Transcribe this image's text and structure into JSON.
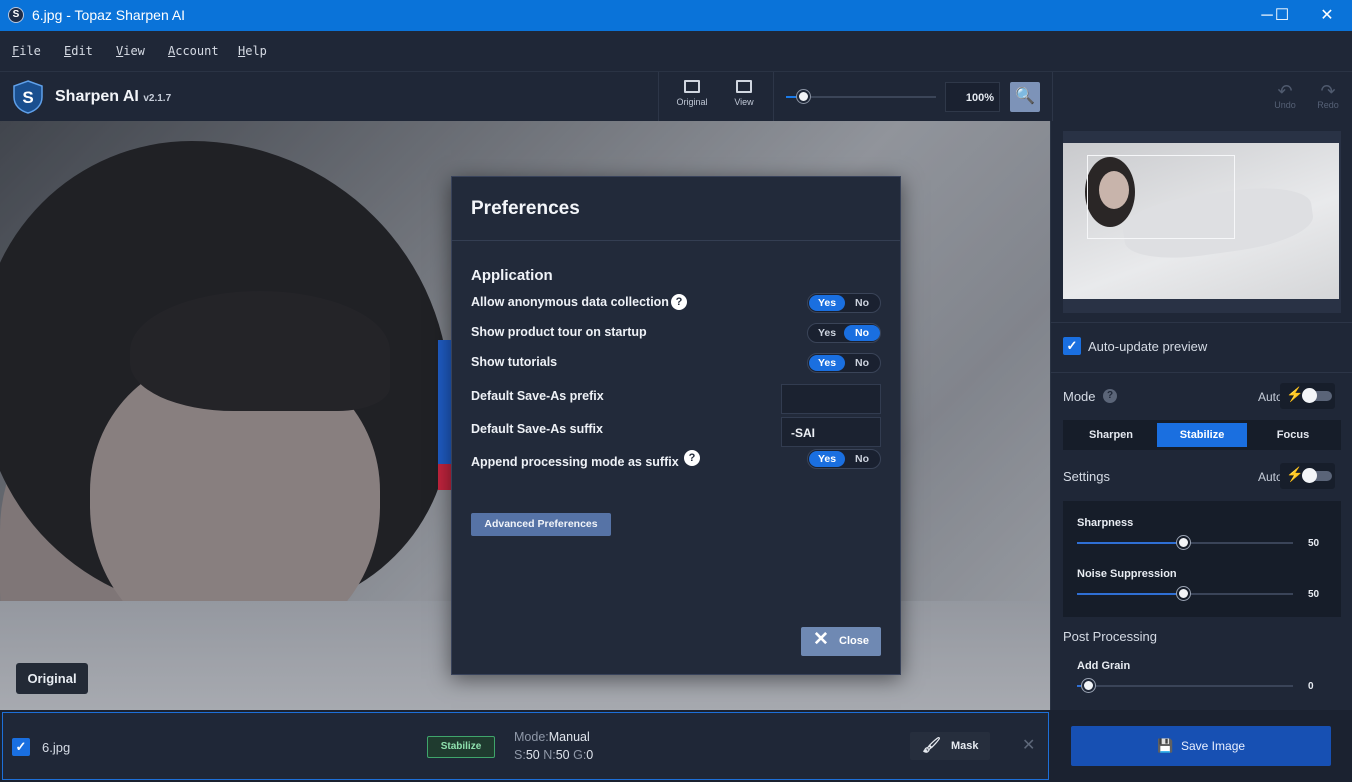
{
  "window": {
    "title": "6.jpg - Topaz Sharpen AI",
    "minimize": "─",
    "maximize": "☐",
    "close": "✕"
  },
  "menu": [
    {
      "label": "File",
      "accel": "F",
      "rest": "ile"
    },
    {
      "label": "Edit",
      "accel": "E",
      "rest": "dit"
    },
    {
      "label": "View",
      "accel": "V",
      "rest": "iew"
    },
    {
      "label": "Account",
      "accel": "A",
      "rest": "ccount"
    },
    {
      "label": "Help",
      "accel": "H",
      "rest": "elp"
    }
  ],
  "toolbar": {
    "brand": "Sharpen AI",
    "version": "v2.1.7",
    "original_label": "Original",
    "view_label": "View",
    "zoom_value": "100%",
    "zoom_level": 0.1,
    "undo_label": "Undo",
    "redo_label": "Redo"
  },
  "canvas": {
    "original_button": "Original"
  },
  "dialog": {
    "title": "Preferences",
    "section": "Application",
    "rows": {
      "anon": {
        "label": "Allow anonymous data collection",
        "value": "Yes"
      },
      "tour": {
        "label": "Show product tour on startup",
        "value": "No"
      },
      "tutorials": {
        "label": "Show tutorials",
        "value": "Yes"
      },
      "prefix": {
        "label": "Default Save-As prefix",
        "value": ""
      },
      "suffix": {
        "label": "Default Save-As suffix",
        "value": "-SAI"
      },
      "append": {
        "label": "Append processing mode as suffix",
        "value": "Yes"
      }
    },
    "yes": "Yes",
    "no": "No",
    "help_glyph": "?",
    "advanced_button": "Advanced Preferences",
    "close_button": "Close"
  },
  "panel": {
    "auto_update_label": "Auto-update preview",
    "auto_update_checked": true,
    "mode_label": "Mode",
    "auto_label": "Auto",
    "mode_tabs": [
      "Sharpen",
      "Stabilize",
      "Focus"
    ],
    "active_mode": "Stabilize",
    "settings_label": "Settings",
    "sharpness_label": "Sharpness",
    "sharpness_value": "50",
    "noise_label": "Noise Suppression",
    "noise_value": "50",
    "post_label": "Post Processing",
    "grain_label": "Add Grain",
    "grain_value": "0"
  },
  "bottom": {
    "file_name": "6.jpg",
    "file_checked": true,
    "mode_badge": "Stabilize",
    "mode_key": "Mode:",
    "mode_value": "Manual",
    "s_key": "S:",
    "s_val": "50",
    "n_key": "N:",
    "n_val": "50",
    "g_key": "G:",
    "g_val": "0",
    "mask_button": "Mask",
    "save_button": "Save Image"
  },
  "colors": {
    "accent": "#1a6fe0",
    "titlebar": "#0a73d9",
    "panel_bg": "#1f2737",
    "dialog_bg": "#222a3a",
    "badge_green": "#3fa56b"
  }
}
